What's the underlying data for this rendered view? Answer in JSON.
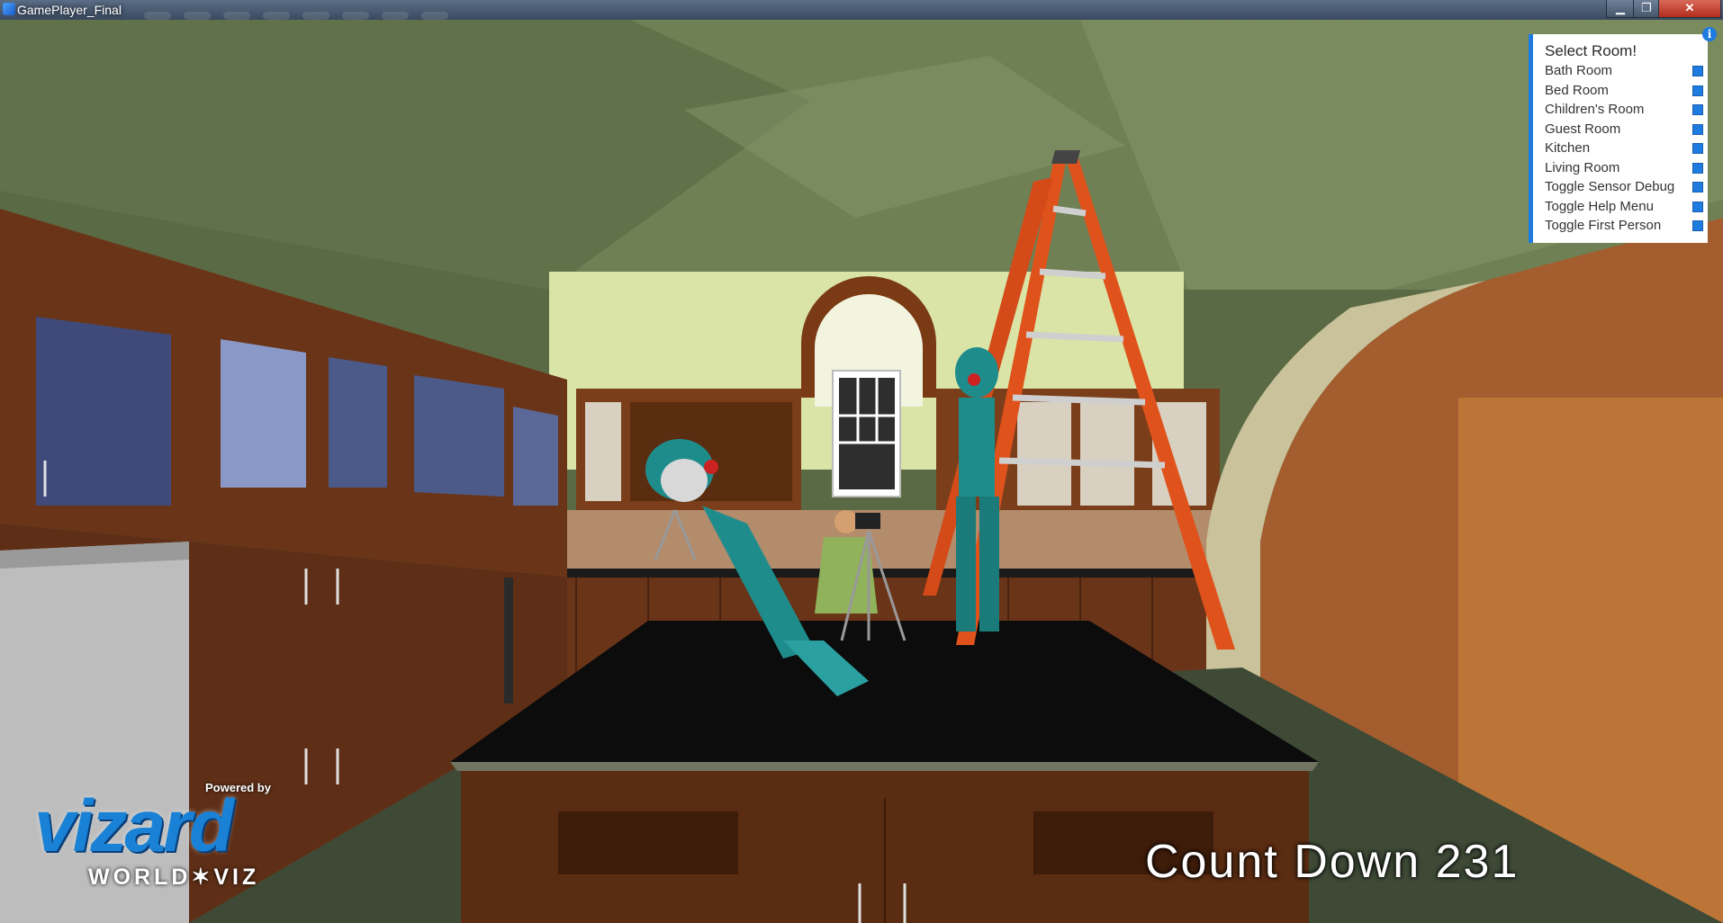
{
  "window": {
    "title": "GamePlayer_Final",
    "min_glyph": "▁",
    "max_glyph": "❐",
    "close_glyph": "✕"
  },
  "menu": {
    "title": "Select Room!",
    "items": [
      {
        "label": "Bath Room",
        "checked": true
      },
      {
        "label": "Bed Room",
        "checked": true
      },
      {
        "label": "Children's Room",
        "checked": true
      },
      {
        "label": "Guest Room",
        "checked": true
      },
      {
        "label": "Kitchen",
        "checked": true
      },
      {
        "label": "Living Room",
        "checked": true
      },
      {
        "label": "Toggle Sensor Debug",
        "checked": true
      },
      {
        "label": "Toggle Help Menu",
        "checked": true
      },
      {
        "label": "Toggle First Person",
        "checked": true
      }
    ],
    "info_glyph": "i",
    "accent_color": "#1e7be0"
  },
  "hud": {
    "countdown": "Count Down 231"
  },
  "logo": {
    "powered": "Powered by",
    "word": "vizard",
    "sub": "WORLD✶VIZ"
  },
  "scene": {
    "description_icon": "3d-kitchen-viewport",
    "colors": {
      "ceiling": "#6f8054",
      "cabinet": "#6a3a1c",
      "countertop": "#0c0c0c",
      "floor": "#3e4a36",
      "ladder": "#e0521c",
      "robot": "#1f8c8c",
      "right_wall": "#a45d2e"
    }
  }
}
